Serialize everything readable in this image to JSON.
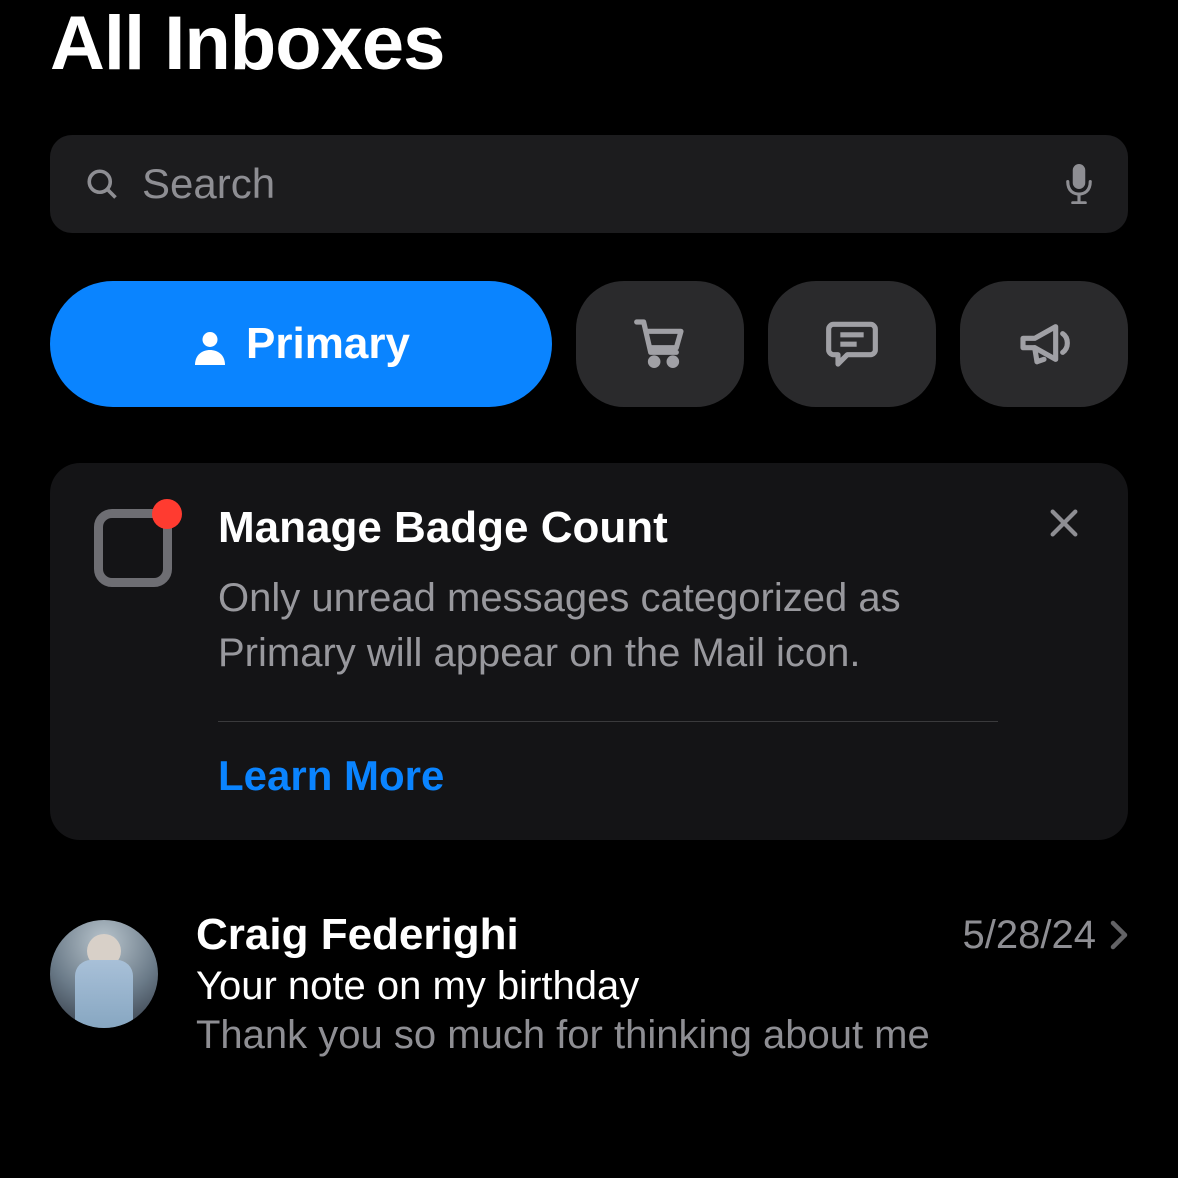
{
  "header": {
    "title": "All Inboxes"
  },
  "search": {
    "placeholder": "Search"
  },
  "categories": {
    "primary_label": "Primary"
  },
  "info_card": {
    "title": "Manage Badge Count",
    "description": "Only unread messages categorized as Primary will appear on the Mail icon.",
    "link_label": "Learn More"
  },
  "messages": [
    {
      "sender": "Craig Federighi",
      "date": "5/28/24",
      "subject": "Your note on my birthday",
      "preview": "Thank you so much for thinking about me"
    }
  ]
}
